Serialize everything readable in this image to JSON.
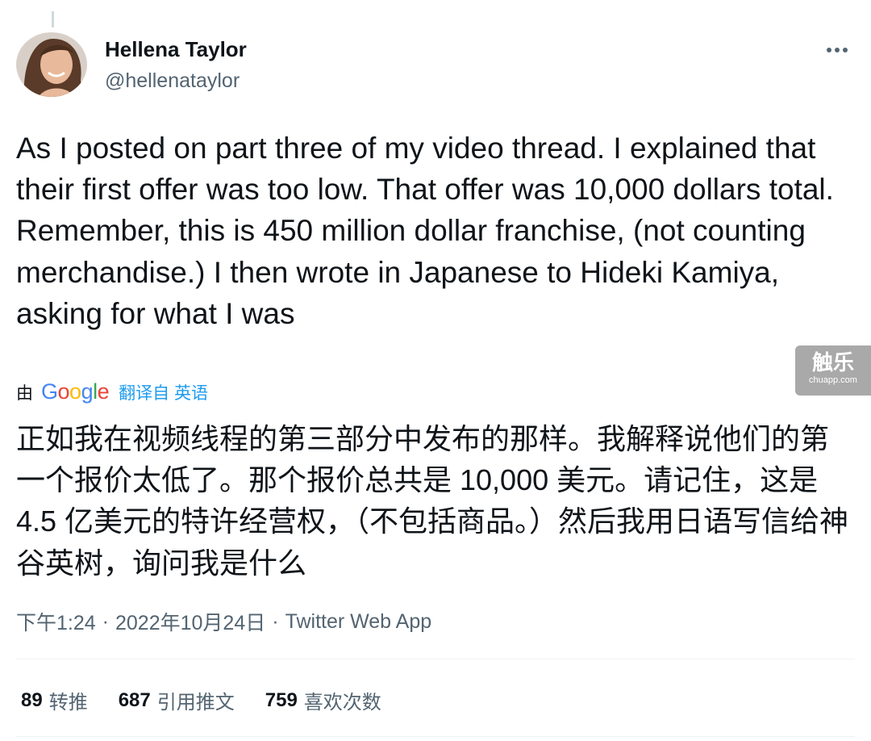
{
  "author": {
    "display_name": "Hellena Taylor",
    "handle": "@hellenataylor"
  },
  "tweet": {
    "text": "As I posted on part three of my video thread.  I explained that their first offer was too low.  That offer was 10,000 dollars total.  Remember, this is 450 million dollar franchise, (not counting merchandise.)  I then wrote in Japanese to Hideki Kamiya, asking for what I was"
  },
  "translation": {
    "by_prefix": "由",
    "google_letters": [
      "G",
      "o",
      "o",
      "g",
      "l",
      "e"
    ],
    "google_colors": [
      "#4285F4",
      "#EA4335",
      "#FBBC05",
      "#4285F4",
      "#34A853",
      "#EA4335"
    ],
    "link_label": "翻译自 英语",
    "text": "正如我在视频线程的第三部分中发布的那样。我解释说他们的第一个报价太低了。那个报价总共是 10,000 美元。请记住，这是 4.5 亿美元的特许经营权，（不包括商品。）然后我用日语写信给神谷英树，询问我是什么"
  },
  "watermark": {
    "logo": "触乐",
    "domain": "chuapp.com"
  },
  "meta": {
    "time": "下午1:24",
    "separator": "·",
    "date": "2022年10月24日",
    "source": "Twitter Web App"
  },
  "stats": {
    "retweets_count": "89",
    "retweets_label": "转推",
    "quotes_count": "687",
    "quotes_label": "引用推文",
    "likes_count": "759",
    "likes_label": "喜欢次数"
  },
  "colors": {
    "accent": "#1d9bf0",
    "text_primary": "#0f1419",
    "text_secondary": "#536471",
    "divider": "#eff3f4"
  },
  "icons": {
    "more": "more-horizontal-icon"
  }
}
